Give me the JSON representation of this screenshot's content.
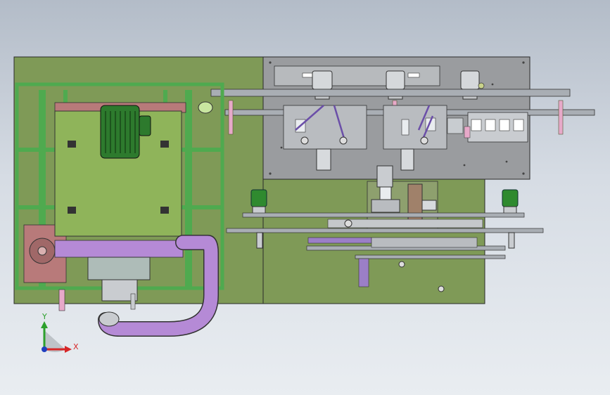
{
  "triad": {
    "y_label": "Y",
    "x_label": "X"
  },
  "colors": {
    "base_plate": "#7f9a57",
    "top_plate": "#9a9c9f",
    "frame": "#4faa4f",
    "motor_body": "#8fb45a",
    "pink_plate": "#b87a7a",
    "purple": "#b58ad6",
    "cylinder": "#e7a9c9",
    "rail": "#a9aeb4",
    "green_motor": "#2f8a2f"
  }
}
